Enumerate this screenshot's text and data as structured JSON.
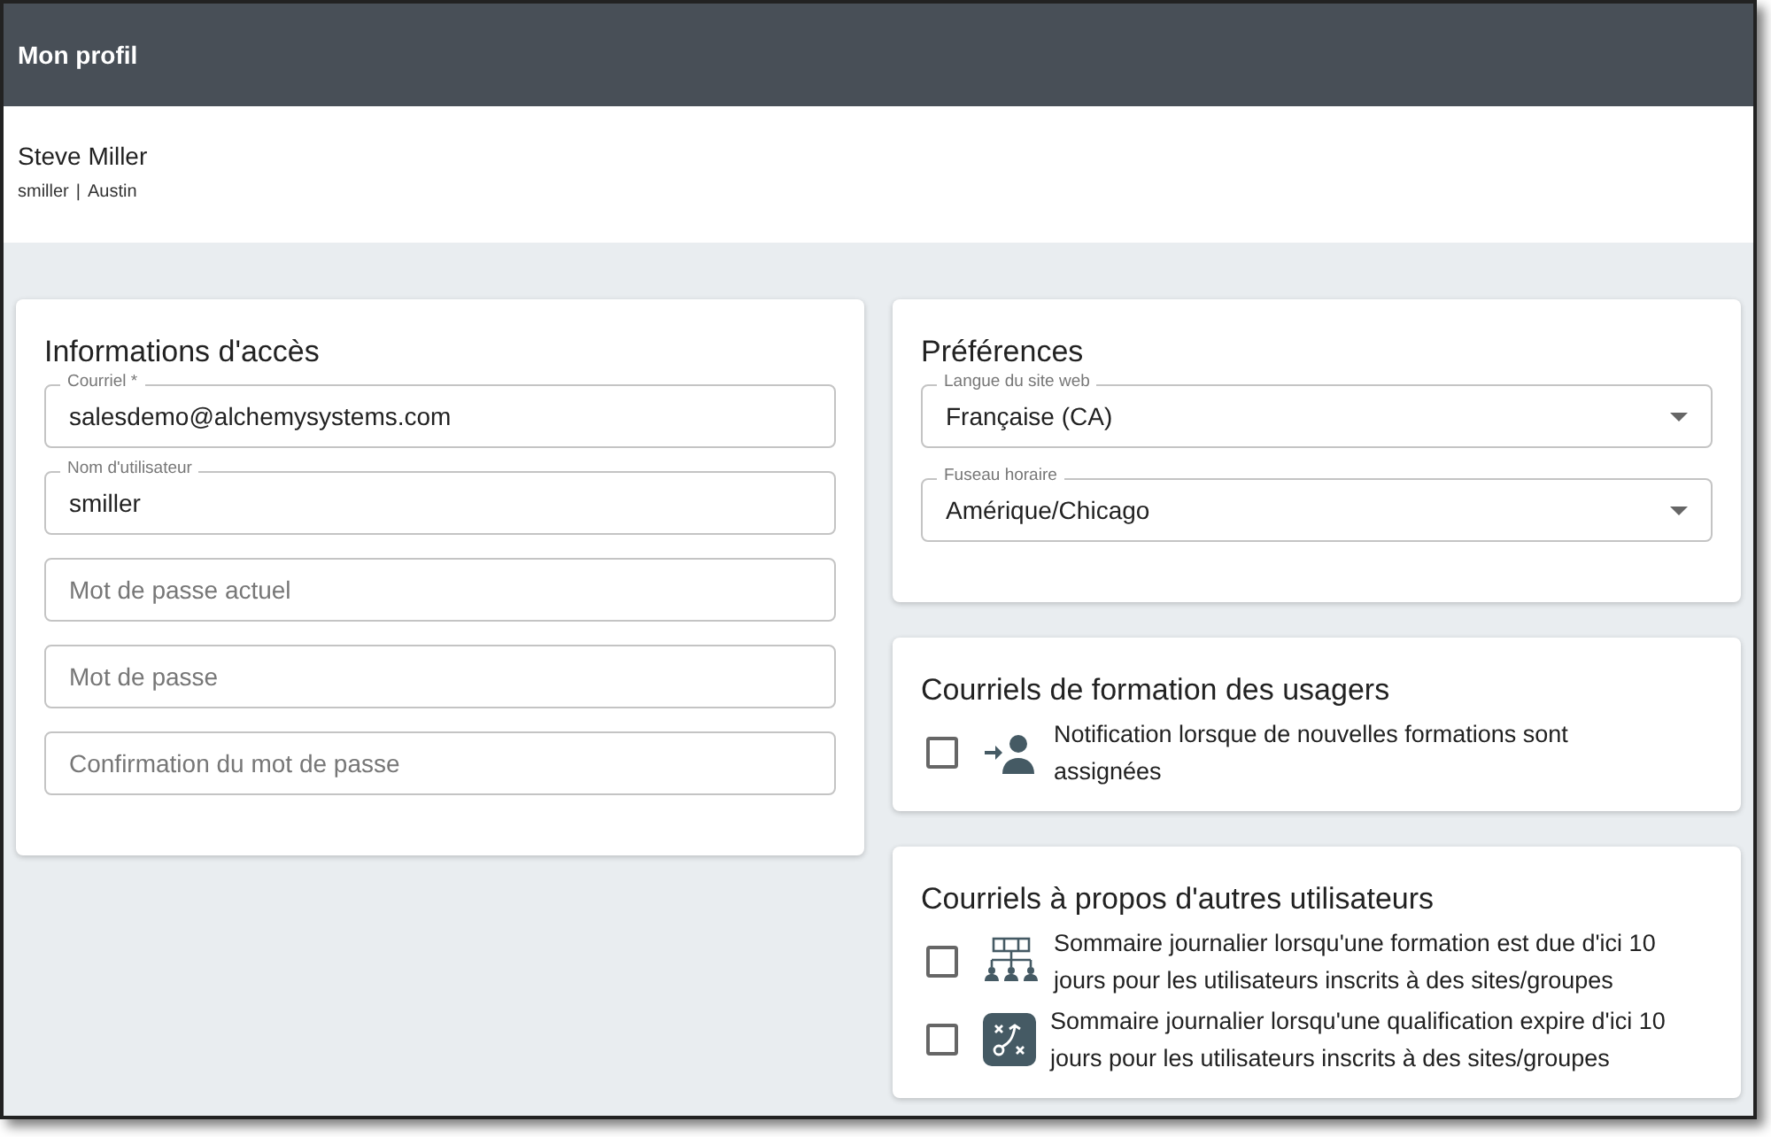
{
  "header": {
    "title": "Mon profil"
  },
  "profile": {
    "name": "Steve Miller",
    "username": "smiller",
    "separator": "|",
    "location": "Austin"
  },
  "access": {
    "title": "Informations d'accès",
    "fields": [
      {
        "label": "Courriel *",
        "value": "salesdemo@alchemysystems.com"
      },
      {
        "label": "Nom d'utilisateur",
        "value": "smiller"
      },
      {
        "placeholder": "Mot de passe actuel"
      },
      {
        "placeholder": "Mot de passe"
      },
      {
        "placeholder": "Confirmation du mot de passe"
      }
    ]
  },
  "preferences": {
    "title": "Préférences",
    "selects": [
      {
        "label": "Langue du site web",
        "value": "Française (CA)"
      },
      {
        "label": "Fuseau horaire",
        "value": "Amérique/Chicago"
      }
    ]
  },
  "training_emails": {
    "title": "Courriels de formation des usagers",
    "options": [
      {
        "kind": "person-arrow",
        "checked": false,
        "text": "Notification lorsque de nouvelles formations sont assignées"
      }
    ]
  },
  "other_emails": {
    "title": "Courriels à propos d'autres utilisateurs",
    "options": [
      {
        "kind": "org-chart",
        "checked": false,
        "text": "Sommaire journalier lorsqu'une formation est due d'ici 10 jours pour les utilisateurs inscrits à des sites/groupes"
      },
      {
        "kind": "strategy",
        "checked": false,
        "text": "Sommaire journalier lorsqu'une qualification expire d'ici 10 jours pour les utilisateurs inscrits à des sites/groupes"
      }
    ]
  }
}
